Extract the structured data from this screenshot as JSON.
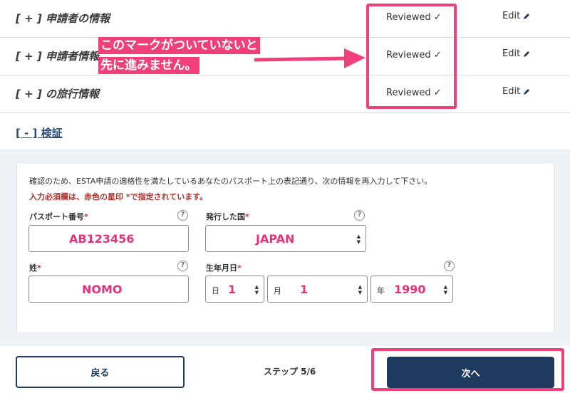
{
  "sections": [
    {
      "title": "[ + ] 申請者の情報",
      "status": "Reviewed ✓",
      "edit": "Edit"
    },
    {
      "title": "[ + ] 申請者情報",
      "status": "Reviewed ✓",
      "edit": "Edit"
    },
    {
      "title": "[ + ] の旅行情報",
      "status": "Reviewed ✓",
      "edit": "Edit"
    }
  ],
  "annotation": {
    "line1": "このマークがついていないと",
    "line2": "先に進みません。"
  },
  "verify": {
    "title": "[ - ] 検証",
    "info": "確認のため、ESTA申請の適格性を満たしているあなたのパスポート上の表記通り、次の情報を再入力して下さい。",
    "required_note": "入力必須欄は、赤色の星印 *で指定されています。"
  },
  "form": {
    "passport_label": "パスポート番号",
    "passport_value": "AB123456",
    "country_label": "発行した国",
    "country_value": "JAPAN",
    "surname_label": "姓",
    "surname_value": "NOMO",
    "dob_label": "生年月日",
    "day_prefix": "日",
    "day_value": "1",
    "month_prefix": "月",
    "month_value": "1",
    "year_prefix": "年",
    "year_value": "1990",
    "star": "*",
    "help": "?"
  },
  "footer": {
    "back": "戻る",
    "step": "ステップ 5/6",
    "next": "次へ"
  },
  "colors": {
    "navy": "#1f3a5f",
    "annotation_pink": "#f0407a",
    "value_pink": "#e8307a",
    "required_red": "#b0302a"
  }
}
